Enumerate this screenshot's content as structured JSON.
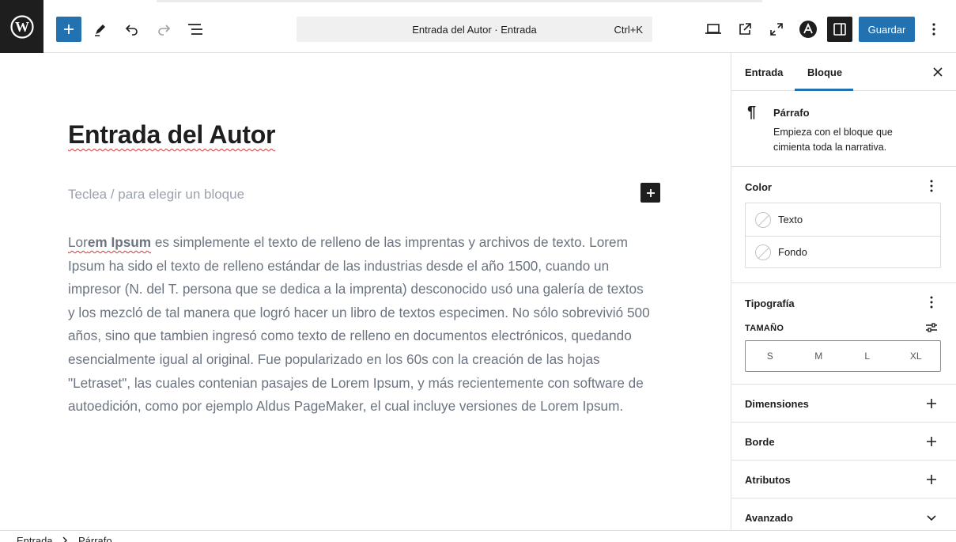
{
  "toolbar": {
    "command_title": "Entrada del Autor · Entrada",
    "command_shortcut": "Ctrl+K",
    "save_label": "Guardar"
  },
  "editor": {
    "post_title": "Entrada del Autor",
    "placeholder": "Teclea / para elegir un bloque",
    "paragraph": {
      "lead": "Lorem Ipsum",
      "lead_plain": "Lor",
      "lead_bold": "em Ipsum",
      "body": " es simplemente el texto de relleno de las imprentas y archivos de texto. Lorem Ipsum ha sido el texto de relleno estándar de las industrias desde el año 1500, cuando un impresor (N. del T. persona que se dedica a la imprenta) desconocido usó una galería de textos y los mezcló de tal manera que logró hacer un libro de textos especimen. No sólo sobrevivió 500 años, sino que tambien ingresó como texto de relleno en documentos electrónicos, quedando esencialmente igual al original. Fue popularizado en los 60s con la creación de las hojas \"Letraset\", las cuales contenian pasajes de Lorem Ipsum, y más recientemente con software de autoedición, como por ejemplo Aldus PageMaker, el cual incluye versiones de Lorem Ipsum."
    }
  },
  "sidebar": {
    "tabs": [
      {
        "label": "Entrada",
        "active": false
      },
      {
        "label": "Bloque",
        "active": true
      }
    ],
    "block": {
      "name": "Párrafo",
      "description": "Empieza con el bloque que cimienta toda la narrativa."
    },
    "color": {
      "title": "Color",
      "items": [
        {
          "label": "Texto"
        },
        {
          "label": "Fondo"
        }
      ]
    },
    "typography": {
      "title": "Tipografía",
      "size_label": "TAMAÑO",
      "sizes": [
        "S",
        "M",
        "L",
        "XL"
      ]
    },
    "panels": [
      {
        "label": "Dimensiones"
      },
      {
        "label": "Borde"
      },
      {
        "label": "Atributos"
      },
      {
        "label": "Avanzado"
      }
    ]
  },
  "breadcrumb": [
    "Entrada",
    "Párrafo"
  ],
  "colors": {
    "accent": "#2271b1",
    "dark": "#1e1e1e",
    "spellcheck": "#d63638"
  }
}
